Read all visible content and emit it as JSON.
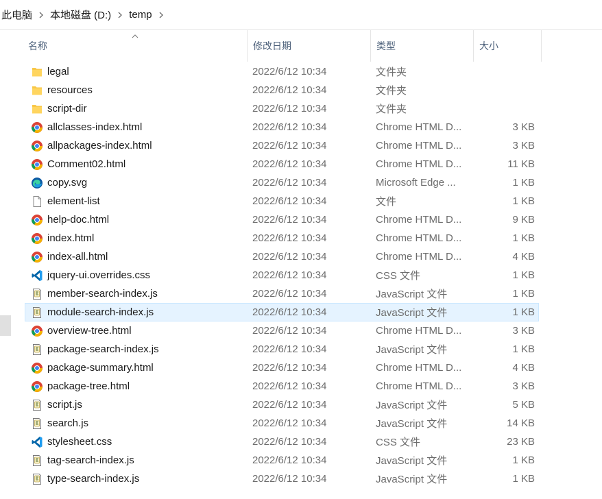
{
  "breadcrumb": [
    "此电脑",
    "本地磁盘 (D:)",
    "temp"
  ],
  "columns": {
    "name": "名称",
    "date": "修改日期",
    "type": "类型",
    "size": "大小"
  },
  "colors": {
    "folder": "#f8c747",
    "chrome_red": "#db4437",
    "chrome_green": "#0f9d58",
    "chrome_yellow": "#f4b400",
    "chrome_blue": "#4285f4",
    "vscode_blue": "#0065a9",
    "edge": "#0c59a4",
    "selection": "#e5f3ff"
  },
  "files": [
    {
      "name": "legal",
      "date": "2022/6/12 10:34",
      "type": "文件夹",
      "size": "",
      "icon": "folder-icon"
    },
    {
      "name": "resources",
      "date": "2022/6/12 10:34",
      "type": "文件夹",
      "size": "",
      "icon": "folder-icon"
    },
    {
      "name": "script-dir",
      "date": "2022/6/12 10:34",
      "type": "文件夹",
      "size": "",
      "icon": "folder-icon"
    },
    {
      "name": "allclasses-index.html",
      "date": "2022/6/12 10:34",
      "type": "Chrome HTML D...",
      "size": "3 KB",
      "icon": "chrome-icon"
    },
    {
      "name": "allpackages-index.html",
      "date": "2022/6/12 10:34",
      "type": "Chrome HTML D...",
      "size": "3 KB",
      "icon": "chrome-icon"
    },
    {
      "name": "Comment02.html",
      "date": "2022/6/12 10:34",
      "type": "Chrome HTML D...",
      "size": "11 KB",
      "icon": "chrome-icon"
    },
    {
      "name": "copy.svg",
      "date": "2022/6/12 10:34",
      "type": "Microsoft Edge ...",
      "size": "1 KB",
      "icon": "edge-icon"
    },
    {
      "name": "element-list",
      "date": "2022/6/12 10:34",
      "type": "文件",
      "size": "1 KB",
      "icon": "file-icon"
    },
    {
      "name": "help-doc.html",
      "date": "2022/6/12 10:34",
      "type": "Chrome HTML D...",
      "size": "9 KB",
      "icon": "chrome-icon"
    },
    {
      "name": "index.html",
      "date": "2022/6/12 10:34",
      "type": "Chrome HTML D...",
      "size": "1 KB",
      "icon": "chrome-icon"
    },
    {
      "name": "index-all.html",
      "date": "2022/6/12 10:34",
      "type": "Chrome HTML D...",
      "size": "4 KB",
      "icon": "chrome-icon"
    },
    {
      "name": "jquery-ui.overrides.css",
      "date": "2022/6/12 10:34",
      "type": "CSS 文件",
      "size": "1 KB",
      "icon": "vscode-icon"
    },
    {
      "name": "member-search-index.js",
      "date": "2022/6/12 10:34",
      "type": "JavaScript 文件",
      "size": "1 KB",
      "icon": "js-script-icon"
    },
    {
      "name": "module-search-index.js",
      "date": "2022/6/12 10:34",
      "type": "JavaScript 文件",
      "size": "1 KB",
      "icon": "js-script-icon",
      "selected": true
    },
    {
      "name": "overview-tree.html",
      "date": "2022/6/12 10:34",
      "type": "Chrome HTML D...",
      "size": "3 KB",
      "icon": "chrome-icon"
    },
    {
      "name": "package-search-index.js",
      "date": "2022/6/12 10:34",
      "type": "JavaScript 文件",
      "size": "1 KB",
      "icon": "js-script-icon"
    },
    {
      "name": "package-summary.html",
      "date": "2022/6/12 10:34",
      "type": "Chrome HTML D...",
      "size": "4 KB",
      "icon": "chrome-icon"
    },
    {
      "name": "package-tree.html",
      "date": "2022/6/12 10:34",
      "type": "Chrome HTML D...",
      "size": "3 KB",
      "icon": "chrome-icon"
    },
    {
      "name": "script.js",
      "date": "2022/6/12 10:34",
      "type": "JavaScript 文件",
      "size": "5 KB",
      "icon": "js-script-icon"
    },
    {
      "name": "search.js",
      "date": "2022/6/12 10:34",
      "type": "JavaScript 文件",
      "size": "14 KB",
      "icon": "js-script-icon"
    },
    {
      "name": "stylesheet.css",
      "date": "2022/6/12 10:34",
      "type": "CSS 文件",
      "size": "23 KB",
      "icon": "vscode-icon"
    },
    {
      "name": "tag-search-index.js",
      "date": "2022/6/12 10:34",
      "type": "JavaScript 文件",
      "size": "1 KB",
      "icon": "js-script-icon"
    },
    {
      "name": "type-search-index.js",
      "date": "2022/6/12 10:34",
      "type": "JavaScript 文件",
      "size": "1 KB",
      "icon": "js-script-icon"
    }
  ]
}
